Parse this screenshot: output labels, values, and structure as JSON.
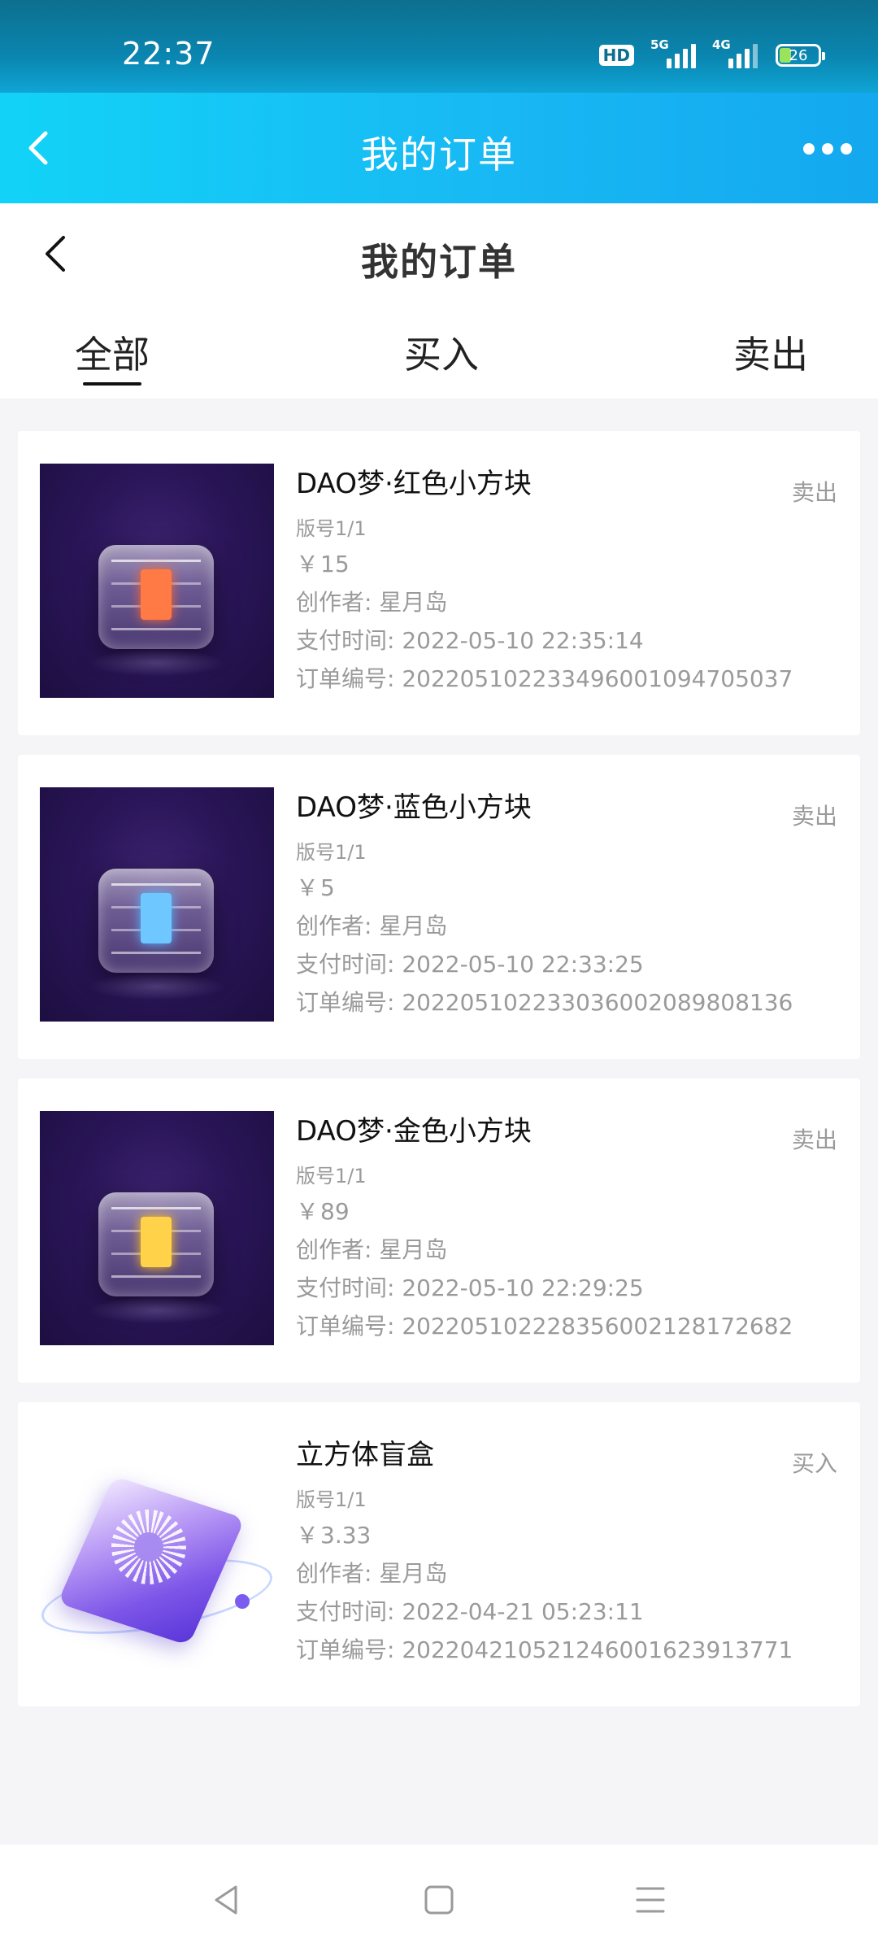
{
  "status_bar": {
    "time": "22:37",
    "hd_badge": "HD",
    "network1": "5G",
    "network2": "4G",
    "battery": "26"
  },
  "app_bar": {
    "title": "我的订单",
    "back_icon": "chevron-left-icon",
    "more_icon": "more-dots-icon"
  },
  "page_header": {
    "title": "我的订单",
    "back_icon": "chevron-left-icon"
  },
  "tabs": [
    {
      "label": "全部",
      "active": true
    },
    {
      "label": "买入",
      "active": false
    },
    {
      "label": "卖出",
      "active": false
    }
  ],
  "orders": [
    {
      "name": "DAO梦·红色小方块",
      "edition": "版号1/1",
      "currency": "￥",
      "price": "15",
      "creator_label": "创作者:",
      "creator": "星月岛",
      "pay_time_label": "支付时间:",
      "pay_time": "2022-05-10 22:35:14",
      "order_no_label": "订单编号:",
      "order_no": "20220510223349600109470503​7",
      "type": "卖出"
    },
    {
      "name": "DAO梦·蓝色小方块",
      "edition": "版号1/1",
      "currency": "￥",
      "price": "5",
      "creator_label": "创作者:",
      "creator": "星月岛",
      "pay_time_label": "支付时间:",
      "pay_time": "2022-05-10 22:33:25",
      "order_no_label": "订单编号:",
      "order_no": "202205102233036002089808136",
      "type": "卖出"
    },
    {
      "name": "DAO梦·金色小方块",
      "edition": "版号1/1",
      "currency": "￥",
      "price": "89",
      "creator_label": "创作者:",
      "creator": "星月岛",
      "pay_time_label": "支付时间:",
      "pay_time": "2022-05-10 22:29:25",
      "order_no_label": "订单编号:",
      "order_no": "202205102228356002128172682",
      "type": "卖出"
    },
    {
      "name": "立方体盲盒",
      "edition": "版号1/1",
      "currency": "￥",
      "price": "3.33",
      "creator_label": "创作者:",
      "creator": "星月岛",
      "pay_time_label": "支付时间:",
      "pay_time": "2022-04-21 05:23:11",
      "order_no_label": "订单编号:",
      "order_no": "202204210521246001623913771",
      "type": "买入"
    }
  ],
  "nav_bar": {
    "back_icon": "triangle-back-icon",
    "home_icon": "square-home-icon",
    "menu_icon": "menu-lines-icon"
  },
  "colors": {
    "header_gradient_start": "#12d3f7",
    "header_gradient_end": "#14a8ef",
    "thumb_dark": "#2a1558",
    "muted_text": "#9a9a9a"
  }
}
